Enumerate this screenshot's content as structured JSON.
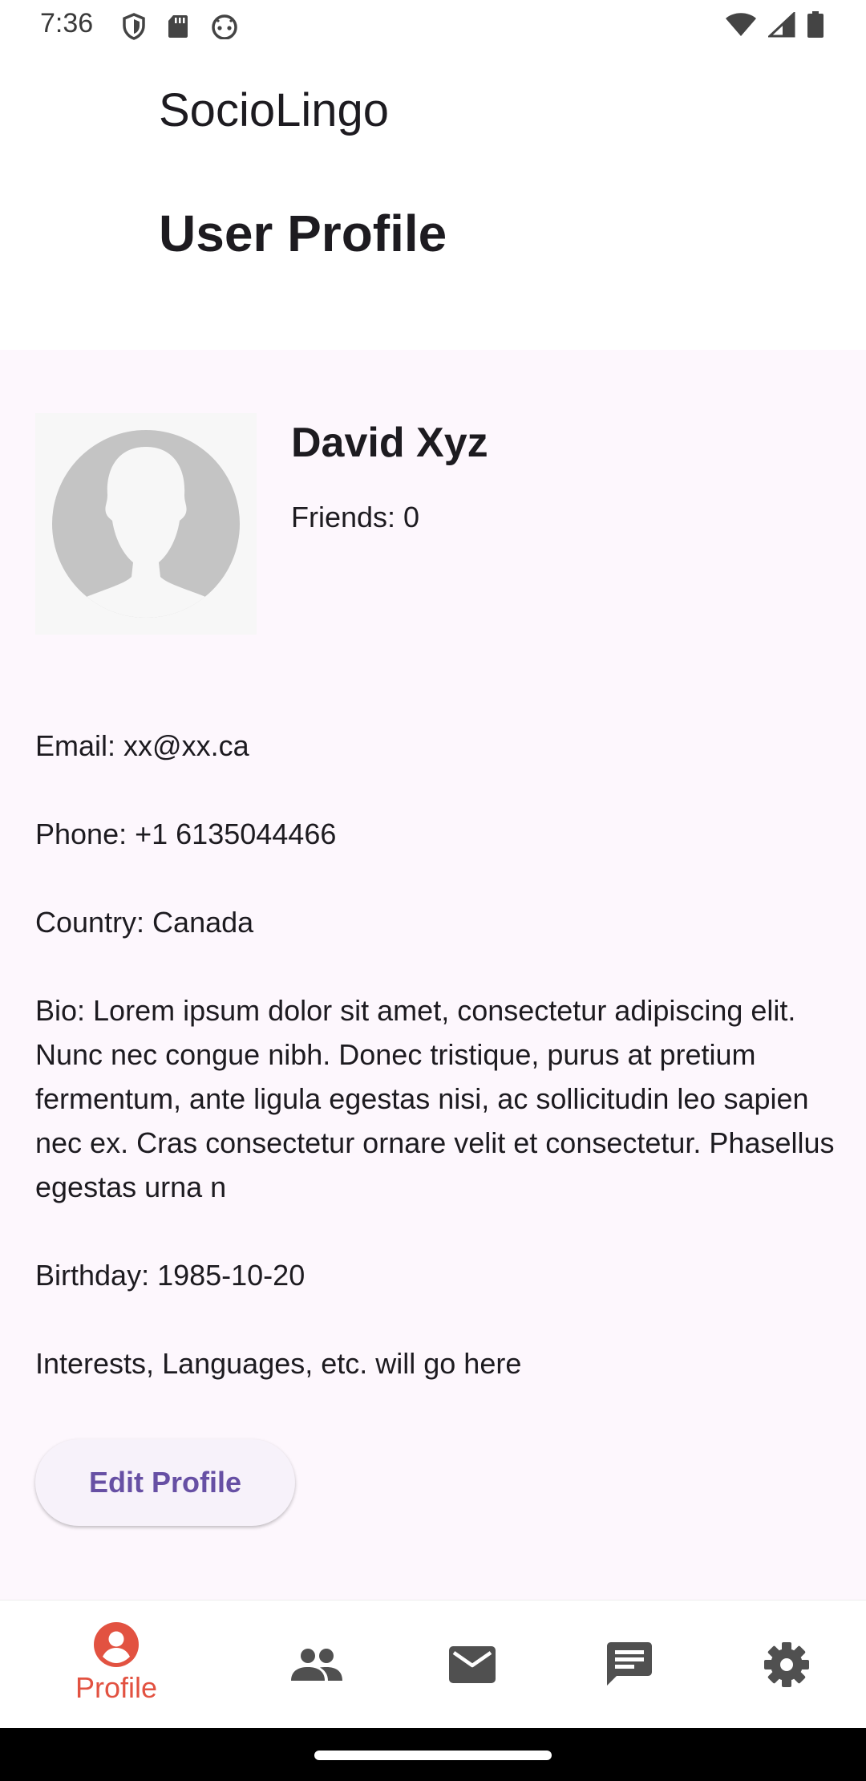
{
  "status_bar": {
    "time": "7:36",
    "left_icons": [
      "shield-icon",
      "sd-card-icon",
      "android-face-icon"
    ],
    "right_icons": [
      "wifi-icon",
      "cell-signal-icon",
      "battery-icon"
    ]
  },
  "app": {
    "title": "SocioLingo",
    "page_title": "User Profile"
  },
  "profile": {
    "name": "David Xyz",
    "friends": "Friends: 0",
    "avatar_icon": "person-silhouette-icon"
  },
  "info": {
    "email": "Email: xx@xx.ca",
    "phone": "Phone: +1 6135044466",
    "country": "Country: Canada",
    "bio": "Bio: Lorem ipsum dolor sit amet, consectetur adipiscing elit. Nunc nec congue nibh. Donec tristique, purus at pretium fermentum, ante ligula egestas nisi, ac sollicitudin leo sapien nec ex. Cras consectetur ornare velit et consectetur. Phasellus egestas urna n",
    "birthday": "Birthday: 1985-10-20",
    "interests": "Interests, Languages, etc. will go here"
  },
  "actions": {
    "edit_label": "Edit Profile"
  },
  "bottom_nav": {
    "items": [
      {
        "label": "Profile",
        "icon": "profile-icon",
        "active": true
      },
      {
        "label": "",
        "icon": "friends-icon",
        "active": false
      },
      {
        "label": "",
        "icon": "mail-icon",
        "active": false
      },
      {
        "label": "",
        "icon": "chat-icon",
        "active": false
      },
      {
        "label": "",
        "icon": "settings-icon",
        "active": false
      }
    ]
  },
  "colors": {
    "active_nav": "#e25241",
    "inactive_nav": "#505050",
    "button_text": "#6750a4",
    "background": "#fdf7fd"
  }
}
